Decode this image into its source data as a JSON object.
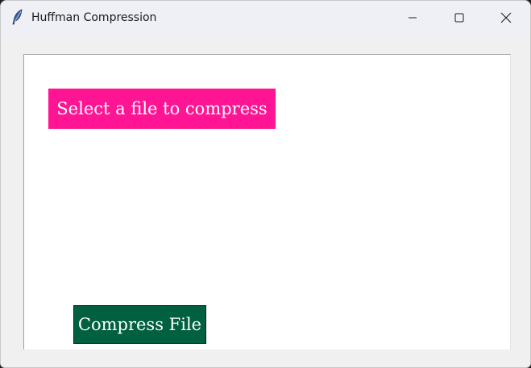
{
  "window": {
    "title": "Huffman Compression",
    "icon": "feather-icon",
    "controls": {
      "minimize": "minimize-icon",
      "maximize": "maximize-icon",
      "close": "close-icon"
    }
  },
  "main": {
    "select_file_label": "Select a file to compress",
    "compress_label": "Compress File"
  },
  "colors": {
    "select_button_bg": "#ff1493",
    "compress_button_bg": "#006040",
    "canvas_bg": "#ffffff",
    "window_bg": "#f0f0f0"
  }
}
